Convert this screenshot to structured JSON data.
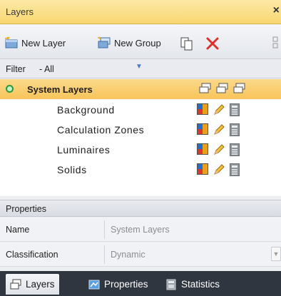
{
  "window": {
    "title": "Layers",
    "close_glyph": "×"
  },
  "toolbar": {
    "new_layer": "New Layer",
    "new_group": "New Group",
    "icons": [
      "new-layer-icon",
      "new-group-icon",
      "copy-icon",
      "delete-icon"
    ]
  },
  "filter": {
    "label": "Filter",
    "value": "- All"
  },
  "tree": {
    "root": {
      "label": "System Layers",
      "status_color": "#2a9a3a"
    },
    "children": [
      {
        "label": "Background"
      },
      {
        "label": "Calculation Zones"
      },
      {
        "label": "Luminaires"
      },
      {
        "label": "Solids"
      }
    ]
  },
  "properties": {
    "header": "Properties",
    "rows": [
      {
        "key": "Name",
        "value": "System Layers"
      },
      {
        "key": "Classification",
        "value": "Dynamic"
      }
    ]
  },
  "tabs": [
    {
      "label": "Layers",
      "icon": "layers-icon",
      "active": true
    },
    {
      "label": "Properties",
      "icon": "properties-icon",
      "active": false
    },
    {
      "label": "Statistics",
      "icon": "statistics-icon",
      "active": false
    }
  ],
  "colors": {
    "title_bar": "#f8d671",
    "selection": "#f7c45a",
    "tab_bar": "#2f3640"
  }
}
